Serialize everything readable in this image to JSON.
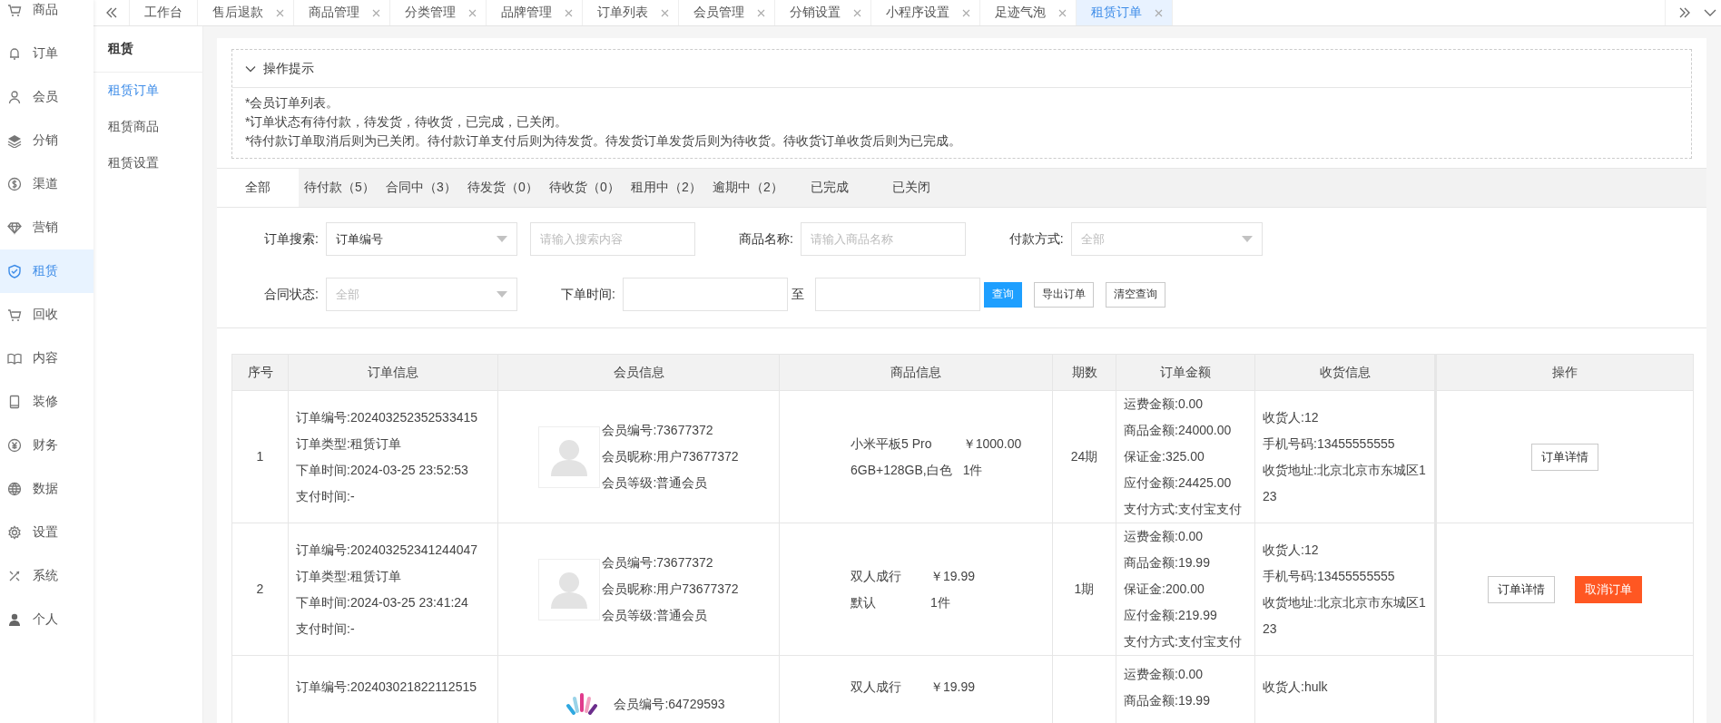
{
  "sidebar": {
    "items": [
      {
        "label": "商品",
        "selected": false
      },
      {
        "label": "订单",
        "selected": false
      },
      {
        "label": "会员",
        "selected": false
      },
      {
        "label": "分销",
        "selected": false
      },
      {
        "label": "渠道",
        "selected": false
      },
      {
        "label": "营销",
        "selected": false
      },
      {
        "label": "租赁",
        "selected": true
      },
      {
        "label": "回收",
        "selected": false
      },
      {
        "label": "内容",
        "selected": false
      },
      {
        "label": "装修",
        "selected": false
      },
      {
        "label": "财务",
        "selected": false
      },
      {
        "label": "数据",
        "selected": false
      },
      {
        "label": "设置",
        "selected": false
      },
      {
        "label": "系统",
        "selected": false
      },
      {
        "label": "个人",
        "selected": false
      }
    ]
  },
  "page_tabs": [
    {
      "label": "工作台",
      "closable": false,
      "selected": false
    },
    {
      "label": "售后退款",
      "closable": true,
      "selected": false
    },
    {
      "label": "商品管理",
      "closable": true,
      "selected": false
    },
    {
      "label": "分类管理",
      "closable": true,
      "selected": false
    },
    {
      "label": "品牌管理",
      "closable": true,
      "selected": false
    },
    {
      "label": "订单列表",
      "closable": true,
      "selected": false
    },
    {
      "label": "会员管理",
      "closable": true,
      "selected": false
    },
    {
      "label": "分销设置",
      "closable": true,
      "selected": false
    },
    {
      "label": "小程序设置",
      "closable": true,
      "selected": false
    },
    {
      "label": "足迹气泡",
      "closable": true,
      "selected": false
    },
    {
      "label": "租赁订单",
      "closable": true,
      "selected": true
    }
  ],
  "subnav": {
    "title": "租赁",
    "items": [
      {
        "label": "租赁订单",
        "selected": true
      },
      {
        "label": "租赁商品",
        "selected": false
      },
      {
        "label": "租赁设置",
        "selected": false
      }
    ]
  },
  "tips": {
    "title": "操作提示",
    "expanded": true,
    "lines": [
      "*会员订单列表。",
      "*订单状态有待付款，待发货，待收货，已完成，已关闭。",
      "*待付款订单取消后则为已关闭。待付款订单支付后则为待发货。待发货订单发货后则为待收货。待收货订单收货后则为已完成。"
    ]
  },
  "status_tabs": [
    {
      "label": "全部",
      "selected": true
    },
    {
      "label": "待付款（5）",
      "selected": false
    },
    {
      "label": "合同中（3）",
      "selected": false
    },
    {
      "label": "待发货（0）",
      "selected": false
    },
    {
      "label": "待收货（0）",
      "selected": false
    },
    {
      "label": "租用中（2）",
      "selected": false
    },
    {
      "label": "逾期中（2）",
      "selected": false
    },
    {
      "label": "已完成",
      "selected": false
    },
    {
      "label": "已关闭",
      "selected": false
    }
  ],
  "filter_rows": [
    [
      {
        "kind": "label",
        "text": "订单搜索:"
      },
      {
        "kind": "select",
        "value": "订单编号"
      },
      {
        "kind": "input",
        "placeholder": "请输入搜索内容"
      },
      {
        "kind": "label",
        "text": "商品名称:"
      },
      {
        "kind": "input",
        "placeholder": "请输入商品名称"
      },
      {
        "kind": "label",
        "text": "付款方式:"
      },
      {
        "kind": "select",
        "placeholder": "全部"
      }
    ],
    [
      {
        "kind": "label",
        "text": "合同状态:"
      },
      {
        "kind": "select",
        "placeholder": "全部"
      },
      {
        "kind": "label",
        "text": "下单时间:"
      },
      {
        "kind": "input"
      },
      {
        "kind": "separator",
        "text": "至"
      },
      {
        "kind": "input"
      },
      {
        "kind": "primary",
        "text": "查询"
      },
      {
        "kind": "button",
        "text": "导出订单"
      },
      {
        "kind": "button",
        "text": "清空查询"
      }
    ]
  ],
  "table": {
    "columns": [
      "序号",
      "订单信息",
      "会员信息",
      "商品信息",
      "期数",
      "订单金额",
      "收货信息",
      "操作"
    ],
    "rows": [
      {
        "index": "1",
        "order_info": [
          "订单编号:202403252352533415",
          "订单类型:租赁订单",
          "下单时间:2024-03-25 23:52:53",
          "支付时间:-"
        ],
        "avatar": {
          "kind": "silhouette"
        },
        "member": [
          "会员编号:73677372",
          "会员昵称:用户73677372",
          "会员等级:普通会员"
        ],
        "goods": [
          [
            "小米平板5 Pro",
            "￥1000.00"
          ],
          [
            "6GB+128GB,白色",
            "1件"
          ]
        ],
        "periods": "24期",
        "amounts": [
          "运费金额:0.00",
          "商品金额:24000.00",
          "保证金:325.00",
          "应付金额:24425.00",
          "支付方式:支付宝支付"
        ],
        "shipping": [
          "收货人:12",
          "手机号码:13455555555",
          "收货地址:北京北京市东城区123"
        ],
        "actions": [
          {
            "label": "订单详情",
            "kind": "default"
          }
        ]
      },
      {
        "index": "2",
        "order_info": [
          "订单编号:202403252341244047",
          "订单类型:租赁订单",
          "下单时间:2024-03-25 23:41:24",
          "支付时间:-"
        ],
        "avatar": {
          "kind": "silhouette"
        },
        "member": [
          "会员编号:73677372",
          "会员昵称:用户73677372",
          "会员等级:普通会员"
        ],
        "goods": [
          [
            "双人成行",
            "￥19.99"
          ],
          [
            "默认",
            "1件"
          ]
        ],
        "periods": "1期",
        "amounts": [
          "运费金额:0.00",
          "商品金额:19.99",
          "保证金:200.00",
          "应付金额:219.99",
          "支付方式:支付宝支付"
        ],
        "shipping": [
          "收货人:12",
          "手机号码:13455555555",
          "收货地址:北京北京市东城区123"
        ],
        "actions": [
          {
            "label": "订单详情",
            "kind": "default"
          },
          {
            "label": "取消订单",
            "kind": "danger"
          }
        ]
      },
      {
        "order_info": [
          "订单编号:202403021822112515"
        ],
        "avatar": {
          "kind": "logo"
        },
        "member": [
          "会员编号:64729593"
        ],
        "goods": [
          [
            "双人成行",
            "￥19.99"
          ]
        ],
        "amounts": [
          "运费金额:0.00",
          "商品金额:19.99"
        ],
        "shipping": [
          "收货人:hulk"
        ]
      }
    ]
  }
}
